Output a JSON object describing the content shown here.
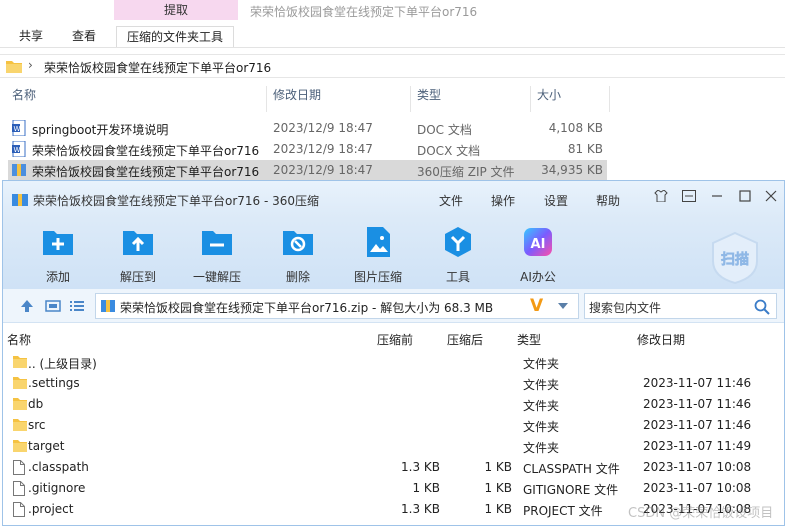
{
  "ribbon": {
    "context_tab_header": "提取",
    "window_title": "荣荣恰饭校园食堂在线预定下单平台or716",
    "tabs": [
      "共享",
      "查看",
      "压缩的文件夹工具"
    ]
  },
  "address": {
    "separator": "›",
    "path": "荣荣恰饭校园食堂在线预定下单平台or716"
  },
  "explorer_list": {
    "headers": [
      "名称",
      "修改日期",
      "类型",
      "大小"
    ],
    "rows": [
      {
        "name": "springboot开发环境说明",
        "date": "2023/12/9 18:47",
        "type": "DOC 文档",
        "size": "4,108 KB",
        "icon": "word-doc-icon",
        "selected": false
      },
      {
        "name": "荣荣恰饭校园食堂在线预定下单平台or716",
        "date": "2023/12/9 18:47",
        "type": "DOCX 文档",
        "size": "81 KB",
        "icon": "word-docx-icon",
        "selected": false
      },
      {
        "name": "荣荣恰饭校园食堂在线预定下单平台or716",
        "date": "2023/12/9 18:47",
        "type": "360压缩 ZIP 文件",
        "size": "34,935 KB",
        "icon": "zip-archive-icon",
        "selected": true
      }
    ]
  },
  "zip_window": {
    "title": "荣荣恰饭校园食堂在线预定下单平台or716 - 360压缩",
    "menu": [
      "文件",
      "操作",
      "设置",
      "帮助"
    ],
    "tools": [
      {
        "label": "添加",
        "icon": "add-icon"
      },
      {
        "label": "解压到",
        "icon": "extract-to-icon"
      },
      {
        "label": "一键解压",
        "icon": "one-click-extract-icon"
      },
      {
        "label": "删除",
        "icon": "delete-icon"
      },
      {
        "label": "图片压缩",
        "icon": "image-compress-icon"
      },
      {
        "label": "工具",
        "icon": "tools-icon"
      },
      {
        "label": "AI办公",
        "icon": "ai-office-icon"
      }
    ],
    "scan_label": "扫描",
    "ai_badge": "AI",
    "path_text": "荣荣恰饭校园食堂在线预定下单平台or716.zip - 解包大小为 68.3 MB",
    "path_logo": "V",
    "search_placeholder": "搜索包内文件",
    "headers": [
      "名称",
      "压缩前",
      "压缩后",
      "类型",
      "修改日期"
    ],
    "rows": [
      {
        "name": ".. (上级目录)",
        "before": "",
        "after": "",
        "type": "文件夹",
        "date": "",
        "kind": "folder"
      },
      {
        "name": ".settings",
        "before": "",
        "after": "",
        "type": "文件夹",
        "date": "2023-11-07 11:46",
        "kind": "folder"
      },
      {
        "name": "db",
        "before": "",
        "after": "",
        "type": "文件夹",
        "date": "2023-11-07 11:46",
        "kind": "folder"
      },
      {
        "name": "src",
        "before": "",
        "after": "",
        "type": "文件夹",
        "date": "2023-11-07 11:46",
        "kind": "folder"
      },
      {
        "name": "target",
        "before": "",
        "after": "",
        "type": "文件夹",
        "date": "2023-11-07 11:49",
        "kind": "folder"
      },
      {
        "name": ".classpath",
        "before": "1.3 KB",
        "after": "1 KB",
        "type": "CLASSPATH 文件",
        "date": "2023-11-07 10:08",
        "kind": "file"
      },
      {
        "name": ".gitignore",
        "before": "1 KB",
        "after": "1 KB",
        "type": "GITIGNORE 文件",
        "date": "2023-11-07 10:08",
        "kind": "file"
      },
      {
        "name": ".project",
        "before": "1.3 KB",
        "after": "1 KB",
        "type": "PROJECT 文件",
        "date": "2023-11-07 10:08",
        "kind": "file"
      }
    ]
  },
  "watermark": "CSDN @荣荣恰饭设项目",
  "colors": {
    "accent": "#1a8fe3",
    "selection": "#d9d9d9",
    "folder": "#f5c242",
    "context_tab": "#f7d8ef"
  }
}
